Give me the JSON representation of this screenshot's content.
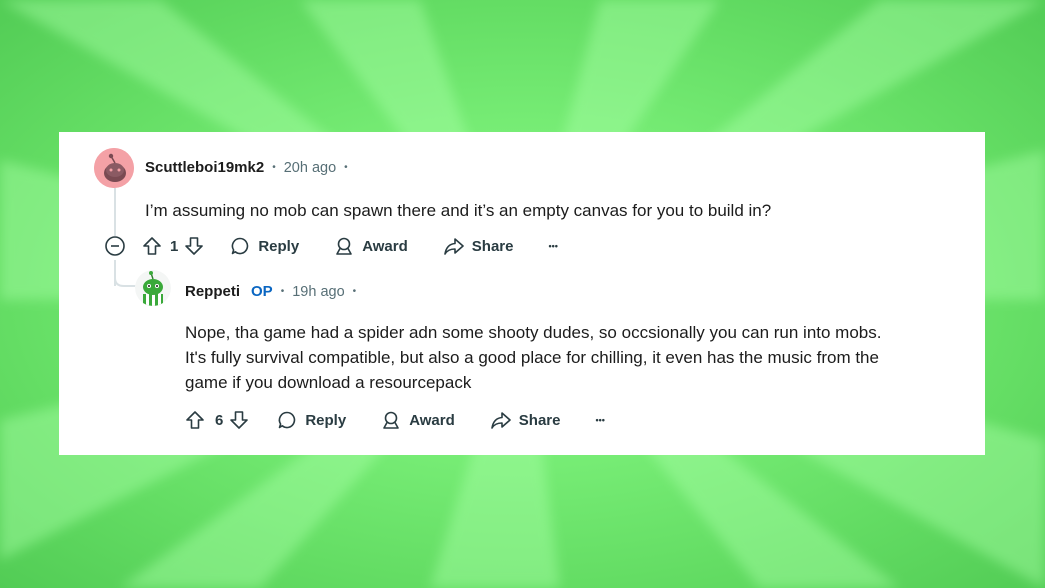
{
  "comments": [
    {
      "username": "Scuttleboi19mk2",
      "sep1": "•",
      "time": "20h ago",
      "sep2": "•",
      "body": "I’m assuming no mob can spawn there and it’s an empty canvas for you to build in?",
      "vote_count": "1",
      "reply_label": "Reply",
      "award_label": "Award",
      "share_label": "Share",
      "more_label": "•••"
    },
    {
      "username": "Reppeti",
      "op_badge": "OP",
      "sep1": "•",
      "time": "19h ago",
      "sep2": "•",
      "body_lines": [
        "Nope, tha game had a spider adn some shooty dudes, so occsionally you can run into mobs.",
        "It's fully survival compatible, but also a good place for chilling, it even has the music from the",
        "game if you download a resourcepack"
      ],
      "vote_count": "6",
      "reply_label": "Reply",
      "award_label": "Award",
      "share_label": "Share",
      "more_label": "•••"
    }
  ],
  "colors": {
    "background": "#7aef78",
    "card": "#ffffff",
    "op_badge": "#0a66c2",
    "meta_text": "#576f76",
    "avatar1": "#f4a1a6",
    "avatar2": "#3aa93a"
  },
  "icons": {
    "collapse": "minus-circle-icon",
    "upvote": "arrow-up-outline-icon",
    "downvote": "arrow-down-outline-icon",
    "reply": "speech-bubble-icon",
    "award": "award-ribbon-icon",
    "share": "share-arrow-icon",
    "more": "ellipsis-icon"
  }
}
